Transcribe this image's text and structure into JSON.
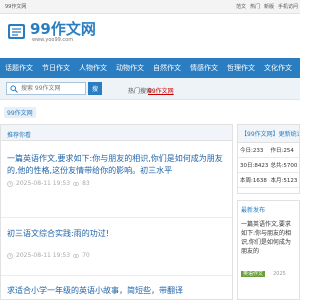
{
  "topbar": {
    "site_name": "99作文网",
    "links": [
      "范文",
      "热门",
      "新版",
      "手机访问"
    ]
  },
  "logo": {
    "title": "99作文网",
    "url": "www.yoo99.com"
  },
  "nav": {
    "items": [
      "话题作文",
      "节日作文",
      "人物作文",
      "动物作文",
      "自然作文",
      "情感作文",
      "哲理作文",
      "文化作文",
      "励志作文"
    ]
  },
  "search": {
    "placeholder": "搜索 99作文网",
    "button_label": "搜",
    "hot_label": "热门搜索:",
    "hot_link": "99作文网"
  },
  "breadcrumb": {
    "label": "99作文网"
  },
  "main": {
    "section_title": "推荐你看",
    "articles": [
      {
        "title": "一篇英语作文,要求如下:你与朋友的相识,你们是如何成为朋友的,他的性格,这份友情带给你的影响。初三水平",
        "date": "2025-08-11 19:53",
        "views": "83"
      },
      {
        "title": "初三语文综合实践:雨的功过!",
        "date": "2025-08-11 19:53",
        "views": "70"
      },
      {
        "title": "求适合小学一年级的英语小故事，简短些，带翻译",
        "date": "",
        "views": ""
      }
    ]
  },
  "sidebar": {
    "stats_title": "【99作文网】更新统计",
    "stats": [
      "今日:233",
      "作日:254",
      "30日:8423",
      "总共:5700",
      "本周:1638",
      "本月:5123"
    ],
    "latest_title": "最新发布",
    "latest_item": "一篇英语作文,要求如下:你与朋友的相识,你们是如何成为朋友的",
    "latest_tag": "英语作文",
    "latest_date": "2025"
  },
  "colors": {
    "brand": "#2a7dc1",
    "link": "#1e62a8",
    "hot": "#cc0000"
  }
}
